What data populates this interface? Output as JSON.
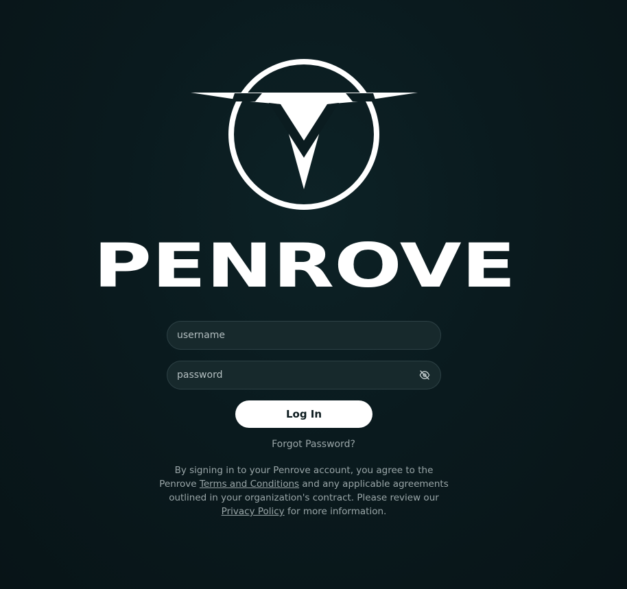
{
  "brand": {
    "name": "PENROVE",
    "logo_icon": "penrove-v-circle-logo"
  },
  "login_form": {
    "username_placeholder": "username",
    "password_placeholder": "password",
    "password_toggle_icon": "eye-off-icon",
    "login_label": "Log In",
    "forgot_password_label": "Forgot Password?"
  },
  "legal": {
    "text_1": "By signing in to your Penrove account, you agree to the Penrove",
    "terms_link": "Terms and Conditions",
    "text_2": "and any applicable agreements outlined in your organization's contract. Please review our",
    "privacy_link": "Privacy Policy",
    "text_3": "for more information."
  },
  "colors": {
    "background": "#0a1a1e",
    "field_background": "#17292c",
    "field_border": "#2e4246",
    "button_background": "#ffffff",
    "muted_text": "#9aa6a8"
  }
}
